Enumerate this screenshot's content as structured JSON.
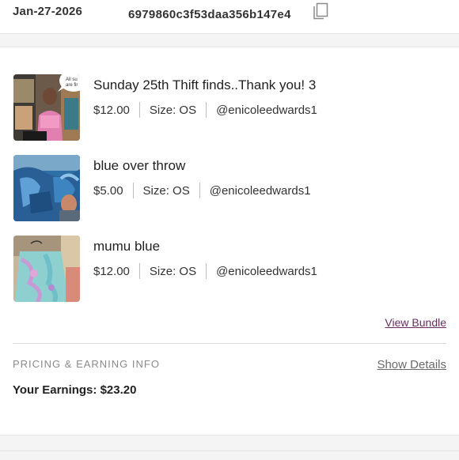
{
  "order": {
    "date": "Jan-27-2026",
    "id": "6979860c3f53daa356b147e4"
  },
  "items": [
    {
      "title": "Sunday 25th Thift finds..Thank you! 3",
      "price": "$12.00",
      "size": "Size: OS",
      "seller": "@enicoleedwards1",
      "thumb_bubble": "All su are fir"
    },
    {
      "title": "blue over throw",
      "price": "$5.00",
      "size": "Size: OS",
      "seller": "@enicoleedwards1"
    },
    {
      "title": "mumu blue",
      "price": "$12.00",
      "size": "Size: OS",
      "seller": "@enicoleedwards1"
    }
  ],
  "bundle": {
    "view_label": "View Bundle"
  },
  "pricing": {
    "heading": "PRICING & EARNING INFO",
    "show_details_label": "Show Details",
    "earnings_label": "Your Earnings:",
    "earnings_value": "$23.20"
  },
  "colors": {
    "accent_link": "#6b2c5f",
    "band_gray": "#f4f4f4"
  },
  "icons": {
    "copy": "copy-icon"
  }
}
